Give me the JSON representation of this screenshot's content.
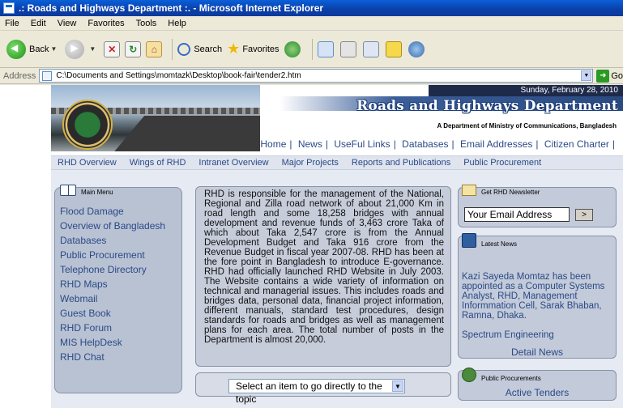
{
  "window": {
    "title": ".: Roads and Highways Department :. - Microsoft Internet Explorer"
  },
  "menubar": {
    "items": [
      "File",
      "Edit",
      "View",
      "Favorites",
      "Tools",
      "Help"
    ]
  },
  "toolbar": {
    "back_label": "Back",
    "search_label": "Search",
    "favorites_label": "Favorites"
  },
  "address": {
    "label": "Address",
    "url": "C:\\Documents and Settings\\momtazk\\Desktop\\book-fair\\tender2.htm",
    "go_label": "Go"
  },
  "banner": {
    "date": "Sunday, February 28, 2010",
    "title": "Roads and Highways Department",
    "subtitle": "A Department of Ministry of Communications, Bangladesh"
  },
  "topnav": {
    "items": [
      "Home",
      "News",
      "UseFul Links",
      "Databases",
      "Email Addresses",
      "Citizen Charter"
    ]
  },
  "secnav": {
    "items": [
      "RHD Overview",
      "Wings of RHD",
      "Intranet Overview",
      "Major Projects",
      "Reports and Publications",
      "Public Procurement"
    ]
  },
  "leftmenu": {
    "header": "Main Menu",
    "items": [
      "Flood Damage",
      "Overview of Bangladesh",
      "Databases",
      "Public Procurement",
      "Telephone Directory",
      "RHD Maps",
      "Webmail",
      "Guest Book",
      "RHD Forum",
      "MIS HelpDesk",
      "RHD Chat"
    ]
  },
  "center": {
    "text": "RHD is responsible for the management of the National, Regional and Zilla road network of about 21,000 Km in road length and some 18,258 bridges with annual development and revenue funds of 3,463 crore Taka of which about Taka 2,547 crore is from the Annual Development Budget and Taka 916 crore from the Revenue Budget in fiscal year 2007-08. RHD has been at the fore point in Bangladesh to introduce E-governance. RHD had officially launched RHD Website in July 2003. The Website contains a wide variety of information on technical and managerial issues. This includes roads and bridges data, personal data, financial project information, different manuals, standard test procedures, design standards for roads and bridges as well as management plans for each area. The total number of posts in the Department is almost 20,000.",
    "select_value": "Select an item to go directly to the topic"
  },
  "newsletter": {
    "header": "Get RHD Newsletter",
    "email_value": "Your Email Address",
    "go_label": ">"
  },
  "news": {
    "header": "Latest News",
    "item1": "Kazi Sayeda Momtaz has been appointed as a Computer Systems Analyst, RHD, Management Informmation Cell, Sarak Bhaban, Ramna, Dhaka.",
    "item2": "Spectrum Engineering",
    "more_label": "Detail News"
  },
  "procurement": {
    "header": "Public Procurements",
    "link": "Active Tenders"
  }
}
